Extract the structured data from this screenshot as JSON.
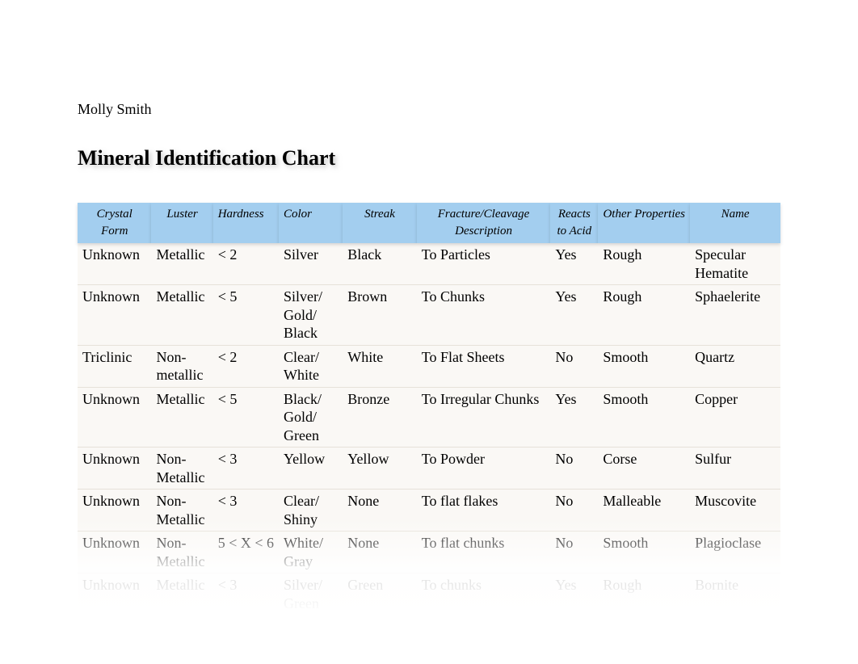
{
  "author": "Molly Smith",
  "title": "Mineral Identification Chart",
  "columns": [
    "Crystal Form",
    "Luster",
    "Hardness",
    "Color",
    "Streak",
    "Fracture/Cleavage Description",
    "Reacts to Acid",
    "Other Properties",
    "Name"
  ],
  "rows": [
    {
      "crystal_form": "Unknown",
      "luster": "Metallic",
      "hardness": "< 2",
      "color": "Silver",
      "streak": "Black",
      "fracture": "To Particles",
      "reacts": "Yes",
      "other": "Rough",
      "name": "Specular Hematite"
    },
    {
      "crystal_form": "Unknown",
      "luster": "Metallic",
      "hardness": "< 5",
      "color": "Silver/ Gold/ Black",
      "streak": "Brown",
      "fracture": "To Chunks",
      "reacts": "Yes",
      "other": "Rough",
      "name": "Sphaelerite"
    },
    {
      "crystal_form": "Triclinic",
      "luster": "Non-metallic",
      "hardness": "< 2",
      "color": "Clear/ White",
      "streak": "White",
      "fracture": "To Flat Sheets",
      "reacts": "No",
      "other": "Smooth",
      "name": "Quartz"
    },
    {
      "crystal_form": "Unknown",
      "luster": "Metallic",
      "hardness": "< 5",
      "color": "Black/ Gold/ Green",
      "streak": "Bronze",
      "fracture": "To Irregular Chunks",
      "reacts": "Yes",
      "other": "Smooth",
      "name": "Copper"
    },
    {
      "crystal_form": "Unknown",
      "luster": "Non-Metallic",
      "hardness": "< 3",
      "color": "Yellow",
      "streak": "Yellow",
      "fracture": "To Powder",
      "reacts": "No",
      "other": "Corse",
      "name": "Sulfur"
    },
    {
      "crystal_form": "Unknown",
      "luster": "Non-Metallic",
      "hardness": "< 3",
      "color": "Clear/ Shiny",
      "streak": "None",
      "fracture": "To flat flakes",
      "reacts": "No",
      "other": "Malleable",
      "name": "Muscovite"
    },
    {
      "crystal_form": "Unknown",
      "luster": "Non-Metallic",
      "hardness": "5 < X < 6",
      "color": "White/ Gray",
      "streak": "None",
      "fracture": "To flat chunks",
      "reacts": "No",
      "other": "Smooth",
      "name": "Plagioclase"
    },
    {
      "crystal_form": "Unknown",
      "luster": "Metallic",
      "hardness": "< 3",
      "color": "Silver/ Green",
      "streak": "Green",
      "fracture": "To chunks",
      "reacts": "Yes",
      "other": "Rough",
      "name": "Bornite"
    }
  ]
}
